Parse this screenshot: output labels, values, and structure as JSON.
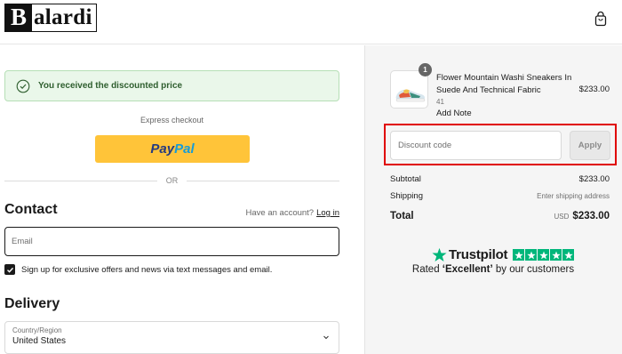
{
  "brand": {
    "logo_first": "B",
    "logo_rest": "alardi"
  },
  "notice": {
    "text": "You received the discounted price"
  },
  "express": {
    "label": "Express checkout",
    "paypal_part1": "Pay",
    "paypal_part2": "Pal"
  },
  "divider": {
    "text": "OR"
  },
  "contact": {
    "title": "Contact",
    "account_prompt": "Have an account?",
    "login_link": "Log in",
    "email_placeholder": "Email",
    "signup_text": "Sign up for exclusive offers and news via text messages and email.",
    "signup_checked": true
  },
  "delivery": {
    "title": "Delivery",
    "country_label": "Country/Region",
    "country_value": "United States"
  },
  "order": {
    "quantity": "1",
    "product_name": "Flower Mountain Washi Sneakers In Suede And Technical Fabric",
    "variant": "41",
    "add_note": "Add Note",
    "price": "$233.00"
  },
  "discount": {
    "placeholder": "Discount code",
    "apply_label": "Apply"
  },
  "summary": {
    "subtotal_label": "Subtotal",
    "subtotal_value": "$233.00",
    "shipping_label": "Shipping",
    "shipping_value": "Enter shipping address",
    "total_label": "Total",
    "total_currency": "USD",
    "total_value": "$233.00"
  },
  "trustpilot": {
    "brand": "Trustpilot",
    "rating_stars": 5,
    "rated_prefix": "Rated ",
    "rated_word": "‘Excellent’",
    "rated_suffix": " by our customers"
  },
  "colors": {
    "paypal_yellow": "#ffc439",
    "trustpilot_green": "#00b67a",
    "highlight_red": "#e00000",
    "notice_green": "#eaf7ea"
  },
  "icons": [
    "shopping-bag-icon",
    "check-circle-icon",
    "checkbox-check-icon",
    "chevron-down-icon",
    "trustpilot-star-icon"
  ]
}
